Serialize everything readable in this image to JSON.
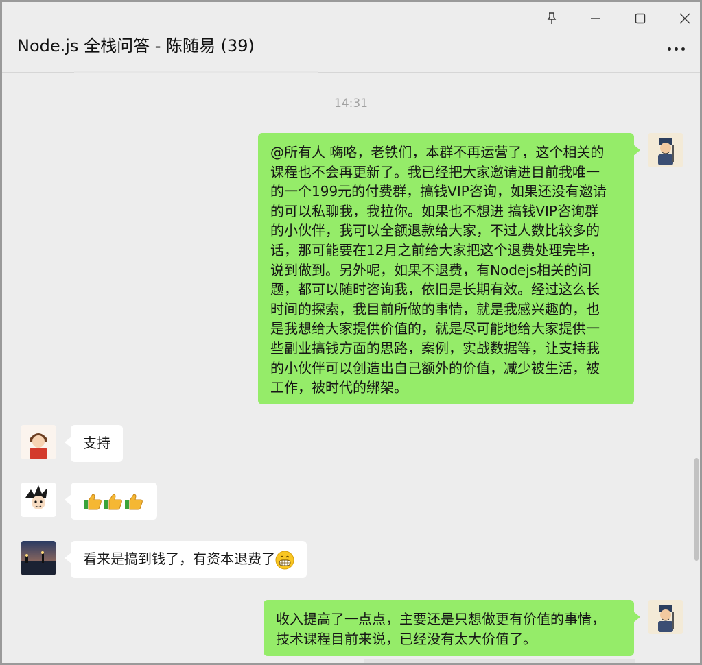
{
  "window": {
    "title": "Node.js 全栈问答 - 陈随易 (39)",
    "controls": {
      "pin": "pin-icon",
      "minimize": "minimize-icon",
      "maximize": "maximize-icon",
      "close": "close-icon"
    },
    "more": "more-icon"
  },
  "chat": {
    "timestamp": "14:31",
    "messages": [
      {
        "sender": "self",
        "avatar": "avatar-swordsman",
        "lines": [
          "@所有人 嗨咯，老铁们，本群不再运营了，这个相关的",
          "课程也不会再更新了。我已经把大家邀请进目前我唯一",
          "的一个199元的付费群，搞钱VIP咨询，如果还没有邀请",
          "的可以私聊我，我拉你。如果也不想进 搞钱VIP咨询群",
          "的小伙伴，我可以全额退款给大家，不过人数比较多的",
          "话，那可能要在12月之前给大家把这个退费处理完毕，",
          "说到做到。另外呢，如果不退费，有Nodejs相关的问",
          "题，都可以随时咨询我，依旧是长期有效。经过这么长",
          "时间的探索，我目前所做的事情，就是我感兴趣的，也",
          "是我想给大家提供价值的，就是尽可能地给大家提供一",
          "些副业搞钱方面的思路，案例，实战数据等，让支持我",
          "的小伙伴可以创造出自己额外的价值，减少被生活，被",
          "工作，被时代的绑架。"
        ]
      },
      {
        "sender": "other",
        "avatar": "avatar-red-jacket",
        "text": "支持"
      },
      {
        "sender": "other",
        "avatar": "avatar-goku",
        "emoji": [
          "thumbs-up-emoji",
          "thumbs-up-emoji",
          "thumbs-up-emoji"
        ]
      },
      {
        "sender": "other",
        "avatar": "avatar-night-city",
        "text": "看来是搞到钱了，有资本退费了",
        "emoji": "grin-emoji"
      },
      {
        "sender": "self",
        "avatar": "avatar-swordsman",
        "lines": [
          "收入提高了一点点，主要还是只想做更有价值的事情，",
          "技术课程目前来说，已经没有太大价值了。"
        ]
      }
    ]
  },
  "colors": {
    "background": "#ededed",
    "self_bubble": "#95ec69",
    "other_bubble": "#ffffff",
    "timestamp": "#a0a0a0"
  }
}
